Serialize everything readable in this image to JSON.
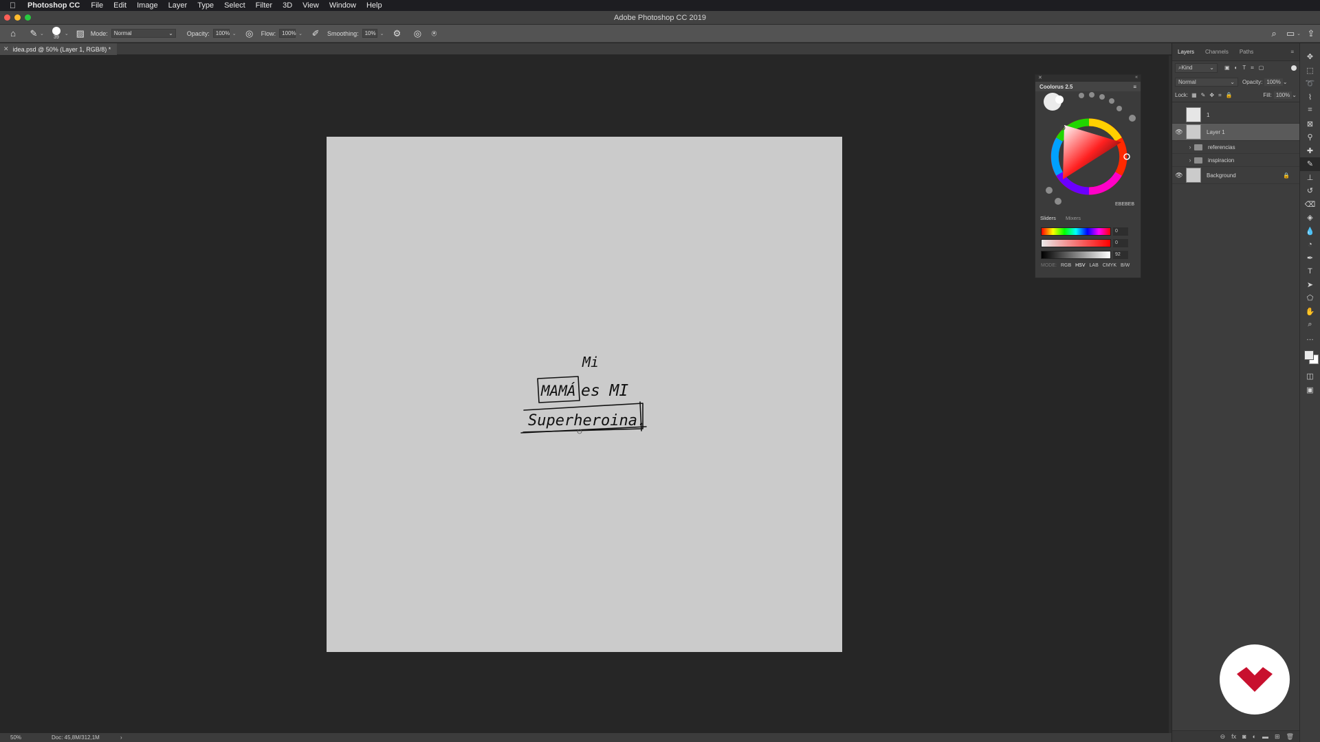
{
  "menubar": {
    "app_name": "Photoshop CC",
    "items": [
      "File",
      "Edit",
      "Image",
      "Layer",
      "Type",
      "Select",
      "Filter",
      "3D",
      "View",
      "Window",
      "Help"
    ]
  },
  "window": {
    "title": "Adobe Photoshop CC 2019"
  },
  "options_bar": {
    "brush_size": "39",
    "mode_label": "Mode:",
    "mode_value": "Normal",
    "opacity_label": "Opacity:",
    "opacity_value": "100%",
    "flow_label": "Flow:",
    "flow_value": "100%",
    "smoothing_label": "Smoothing:",
    "smoothing_value": "10%"
  },
  "document_tab": {
    "title": "idea.psd @ 50% (Layer 1, RGB/8) *"
  },
  "canvas": {
    "handwriting": [
      "Mi",
      "MAMÁ",
      "es MI",
      "Superheroina."
    ]
  },
  "status_bar": {
    "zoom": "50%",
    "doc_info": "Doc: 45,8M/312,1M",
    "arrow": "›"
  },
  "layers_panel": {
    "tabs": [
      "Layers",
      "Channels",
      "Paths"
    ],
    "filter_kind": "Kind",
    "blend_mode": "Normal",
    "opacity_label": "Opacity:",
    "opacity_value": "100%",
    "lock_label": "Lock:",
    "fill_label": "Fill:",
    "fill_value": "100%",
    "layers": [
      {
        "name": "1",
        "visible": false,
        "type": "smart"
      },
      {
        "name": "Layer 1",
        "visible": true,
        "type": "pixel",
        "selected": true
      },
      {
        "name": "referencias",
        "visible": false,
        "type": "group"
      },
      {
        "name": "inspiracion",
        "visible": false,
        "type": "group"
      },
      {
        "name": "Background",
        "visible": true,
        "type": "background",
        "locked": true
      }
    ]
  },
  "colorus": {
    "title": "Coolorus 2.5",
    "hex": "EBEBEB",
    "tabs": [
      "Sliders",
      "Mixers"
    ],
    "slider_values": [
      "0",
      "0",
      "92"
    ],
    "modes_label": "MODE:",
    "modes": [
      "RGB",
      "HSV",
      "LAB",
      "CMYK",
      "B/W"
    ]
  },
  "colors": {
    "accent_red": "#c8102e",
    "canvas": "#cbcbcb",
    "panel": "#3d3d3d"
  }
}
